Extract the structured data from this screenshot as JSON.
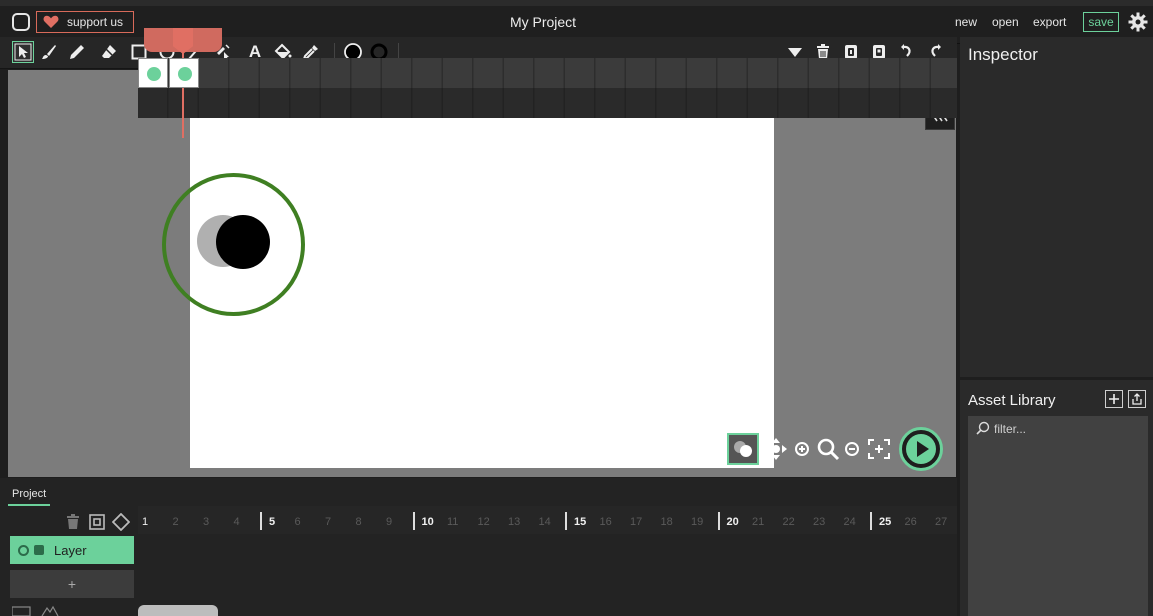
{
  "header": {
    "support_label": "support us",
    "project_title": "My Project",
    "menu": {
      "new": "new",
      "open": "open",
      "export": "export",
      "save": "save"
    }
  },
  "toolbar": {
    "tools": [
      "cursor-icon",
      "brush-icon",
      "pencil-icon",
      "eraser-icon",
      "rectangle-icon",
      "ellipse-icon",
      "line-icon",
      "pathcursor-icon",
      "text-icon",
      "fillbucket-icon",
      "eyedropper-icon"
    ],
    "text_tool_label": "A",
    "selected_tool": "cursor-icon",
    "stroke_color": "#000000",
    "fill_color": "#000000"
  },
  "inspector": {
    "title": "Inspector"
  },
  "assets": {
    "title": "Asset Library",
    "filter_placeholder": "filter..."
  },
  "timeline": {
    "tab": "Project",
    "layer_name": "Layer",
    "add_layer": "+",
    "frames": [
      "1",
      "2",
      "3",
      "4",
      "5",
      "6",
      "7",
      "8",
      "9",
      "10",
      "11",
      "12",
      "13",
      "14",
      "15",
      "16",
      "17",
      "18",
      "19",
      "20",
      "21",
      "22",
      "23",
      "24",
      "25",
      "26",
      "27"
    ],
    "current_frame": 2,
    "keyframes": [
      1,
      2
    ]
  },
  "colors": {
    "accent": "#6cd19b",
    "playhead": "#e06f63",
    "support": "#d86a5a",
    "highlight": "#3f7f22"
  }
}
